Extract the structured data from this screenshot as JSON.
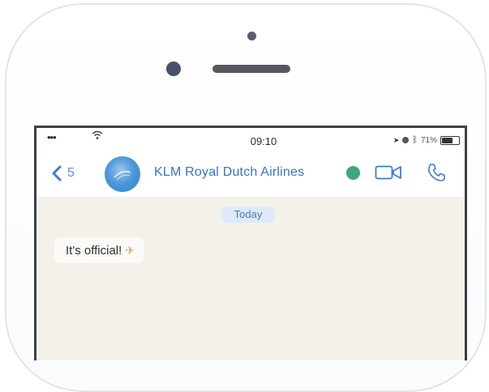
{
  "status_bar": {
    "signal": "•••",
    "time": "09:10",
    "battery_percent": "71%",
    "battery_level": 0.71
  },
  "header": {
    "back_count": "5",
    "contact_name": "KLM Royal Dutch Airlines"
  },
  "chat": {
    "date_label": "Today",
    "messages": [
      {
        "text": "It's official!",
        "emoji": "✈"
      }
    ]
  },
  "colors": {
    "accent": "#3b7ae0",
    "verified": "#3fa778",
    "chat_background": "#f3f1ea"
  },
  "icons": [
    "wifi-icon",
    "location-icon",
    "alarm-icon",
    "bluetooth-icon",
    "battery-icon",
    "back-chevron-icon",
    "video-call-icon",
    "phone-call-icon",
    "verified-icon"
  ]
}
